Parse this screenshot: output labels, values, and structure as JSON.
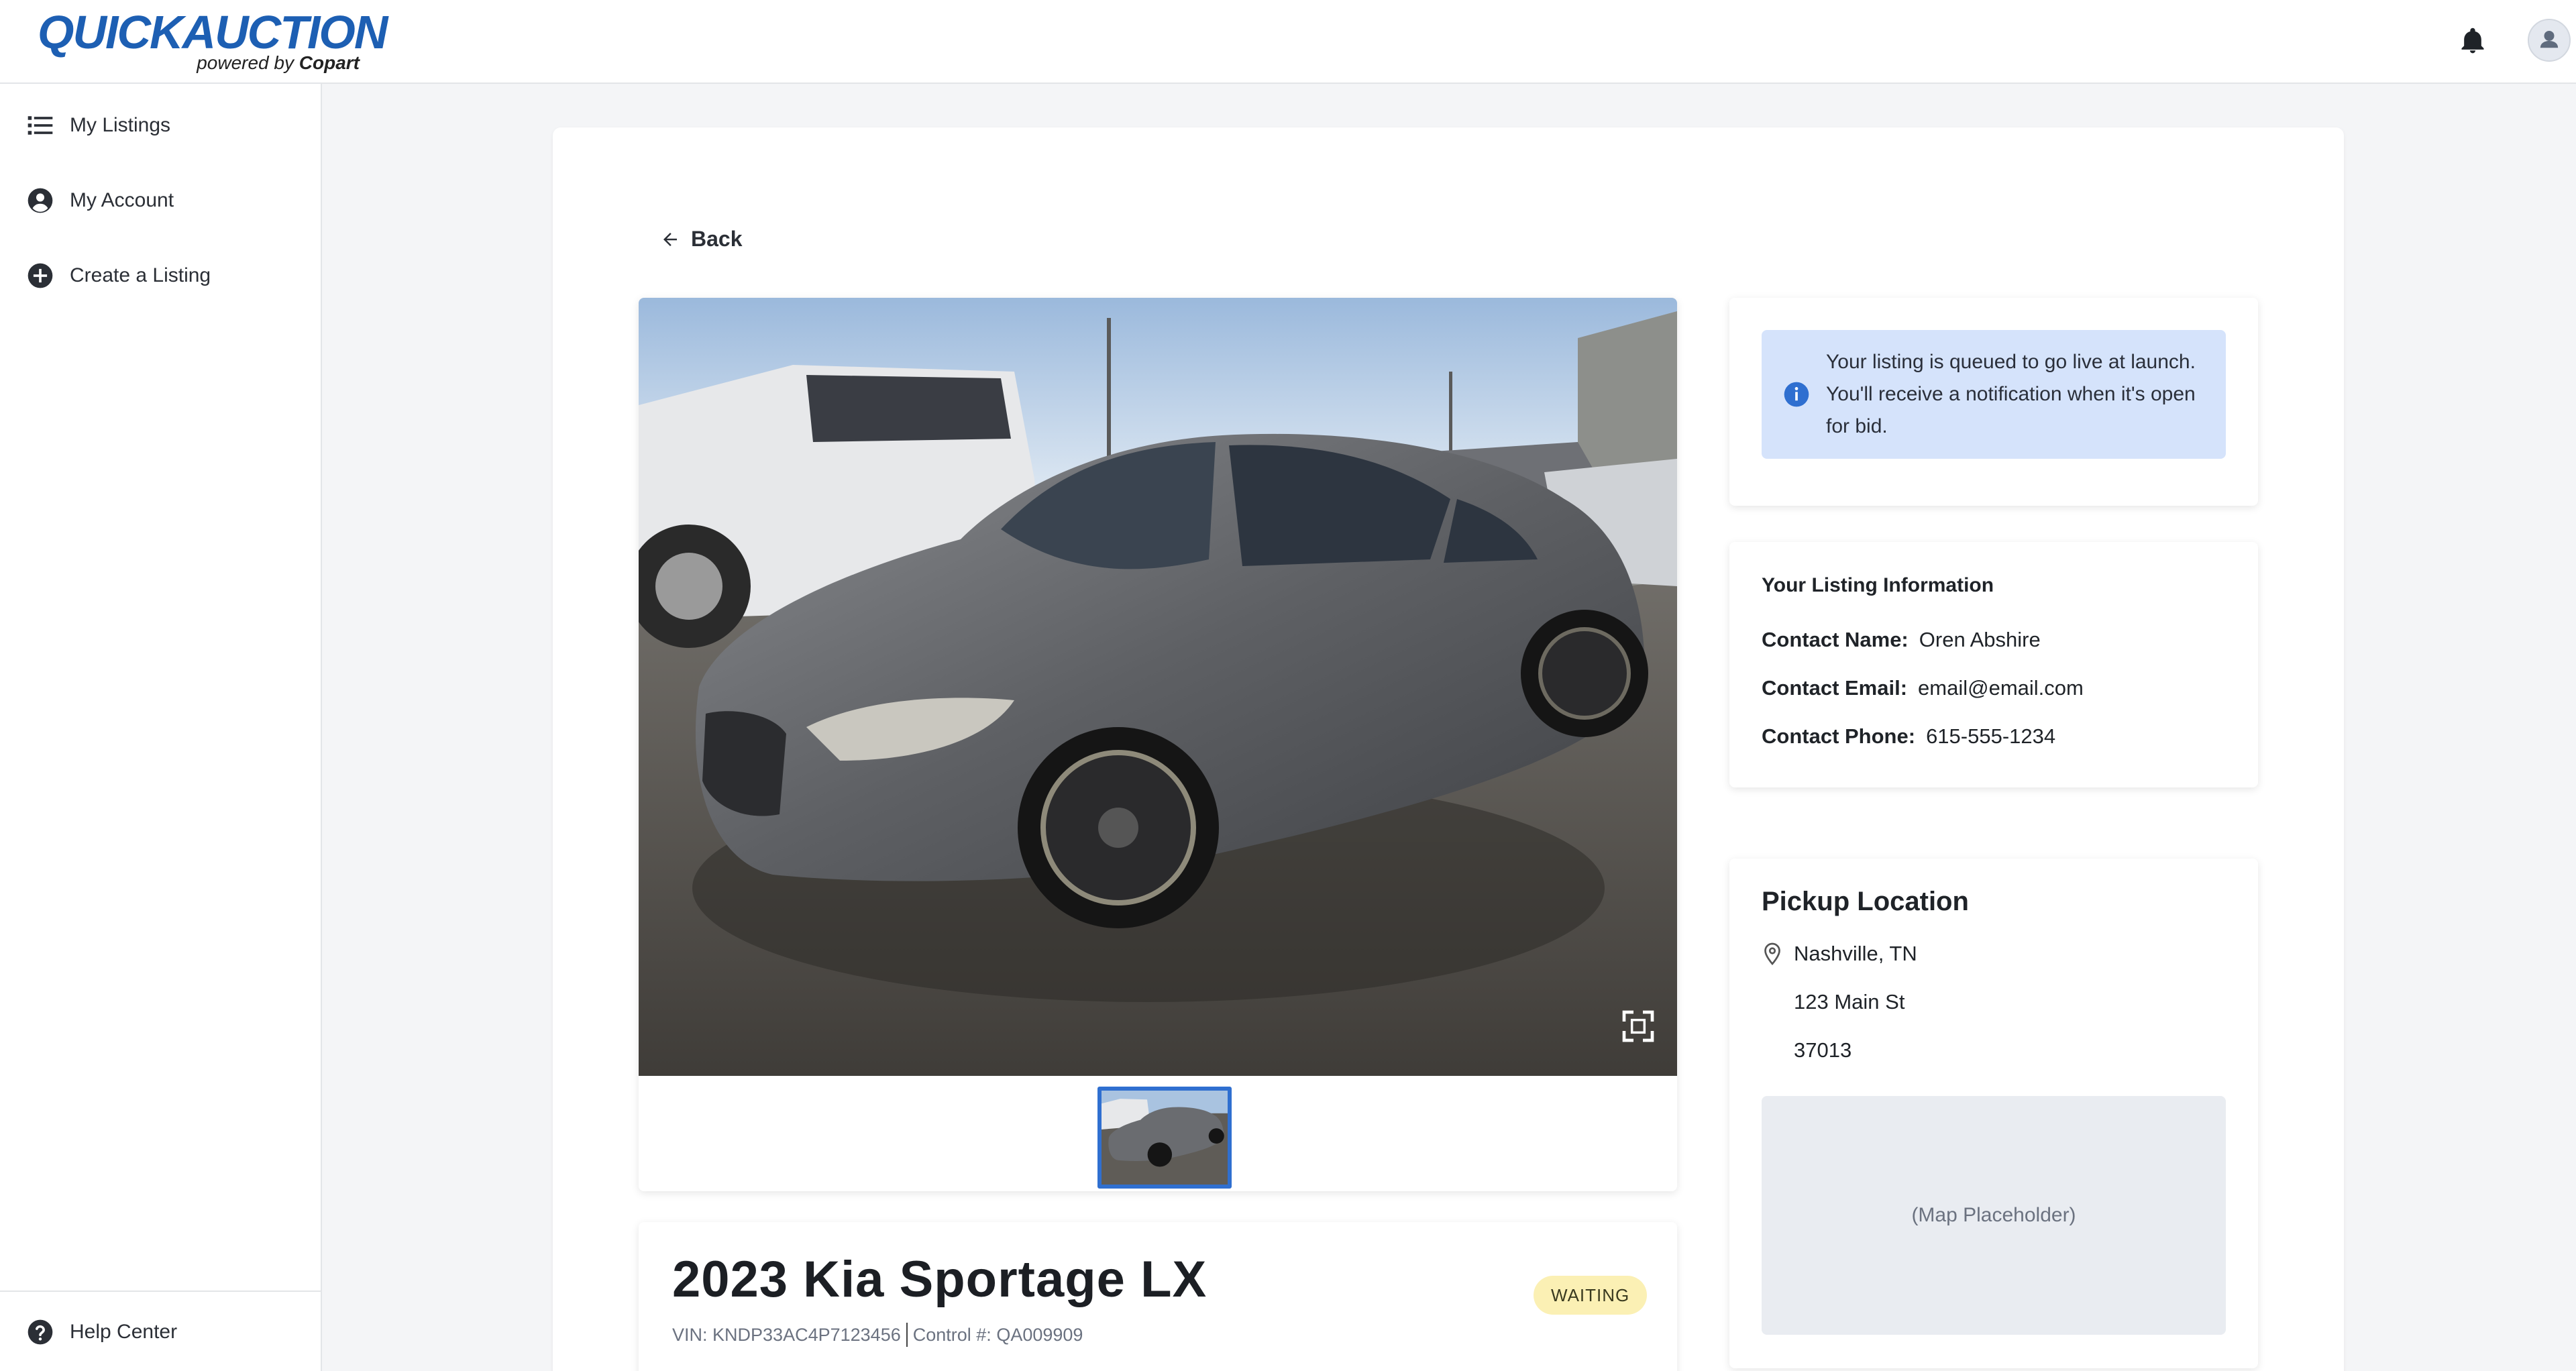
{
  "brand": {
    "logo_text": "QuickAuction",
    "powered_by_prefix": "powered by",
    "powered_by_name": "Copart",
    "accent_color": "#1d5fb3"
  },
  "header": {
    "notification_icon": "bell-icon",
    "account_icon": "avatar-icon"
  },
  "sidebar": {
    "items": [
      {
        "label": "My Listings",
        "icon": "list-icon"
      },
      {
        "label": "My Account",
        "icon": "user-circle-icon"
      },
      {
        "label": "Create a Listing",
        "icon": "plus-circle-icon"
      }
    ],
    "footer": {
      "label": "Help Center",
      "icon": "help-circle-icon"
    }
  },
  "main": {
    "back_label": "Back",
    "gallery": {
      "expand_icon": "expand-icon"
    },
    "listing": {
      "title": "2023 Kia Sportage LX",
      "status": "WAITING",
      "status_color": "#fbf0b4",
      "vin_label": "VIN:",
      "vin": "KNDP33AC4P7123456",
      "control_label": "Control #:",
      "control": "QA009909"
    }
  },
  "notice": {
    "icon": "info-icon",
    "text": "Your listing is queued to go live at launch. You'll receive a notification when it's open for bid."
  },
  "listing_info": {
    "heading": "Your Listing Information",
    "contact_name_label": "Contact Name:",
    "contact_name": "Oren Abshire",
    "contact_email_label": "Contact Email:",
    "contact_email": "email@email.com",
    "contact_phone_label": "Contact Phone:",
    "contact_phone": "615-555-1234"
  },
  "pickup": {
    "heading": "Pickup Location",
    "city": "Nashville, TN",
    "street": "123 Main St",
    "zip": "37013",
    "map_placeholder": "(Map Placeholder)"
  }
}
